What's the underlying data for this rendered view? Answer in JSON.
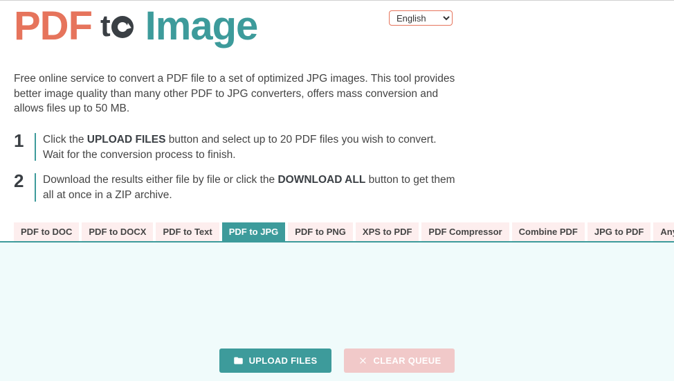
{
  "language": {
    "selected": "English"
  },
  "logo": {
    "part1": "PDF",
    "part2_t": "t",
    "part3": "Image"
  },
  "description": "Free online service to convert a PDF file to a set of optimized JPG images. This tool provides better image quality than many other PDF to JPG converters, offers mass conversion and allows files up to 50 MB.",
  "steps": [
    {
      "num": "1",
      "before": "Click the ",
      "bold": "UPLOAD FILES",
      "after": " button and select up to 20 PDF files you wish to convert. Wait for the conversion process to finish."
    },
    {
      "num": "2",
      "before": "Download the results either file by file or click the ",
      "bold": "DOWNLOAD ALL",
      "after": " button to get them all at once in a ZIP archive."
    }
  ],
  "tabs": [
    {
      "label": "PDF to DOC",
      "active": false
    },
    {
      "label": "PDF to DOCX",
      "active": false
    },
    {
      "label": "PDF to Text",
      "active": false
    },
    {
      "label": "PDF to JPG",
      "active": true
    },
    {
      "label": "PDF to PNG",
      "active": false
    },
    {
      "label": "XPS to PDF",
      "active": false
    },
    {
      "label": "PDF Compressor",
      "active": false
    },
    {
      "label": "Combine PDF",
      "active": false
    },
    {
      "label": "JPG to PDF",
      "active": false
    },
    {
      "label": "Any to PDF",
      "active": false
    }
  ],
  "buttons": {
    "upload": "UPLOAD FILES",
    "clear": "CLEAR QUEUE"
  }
}
